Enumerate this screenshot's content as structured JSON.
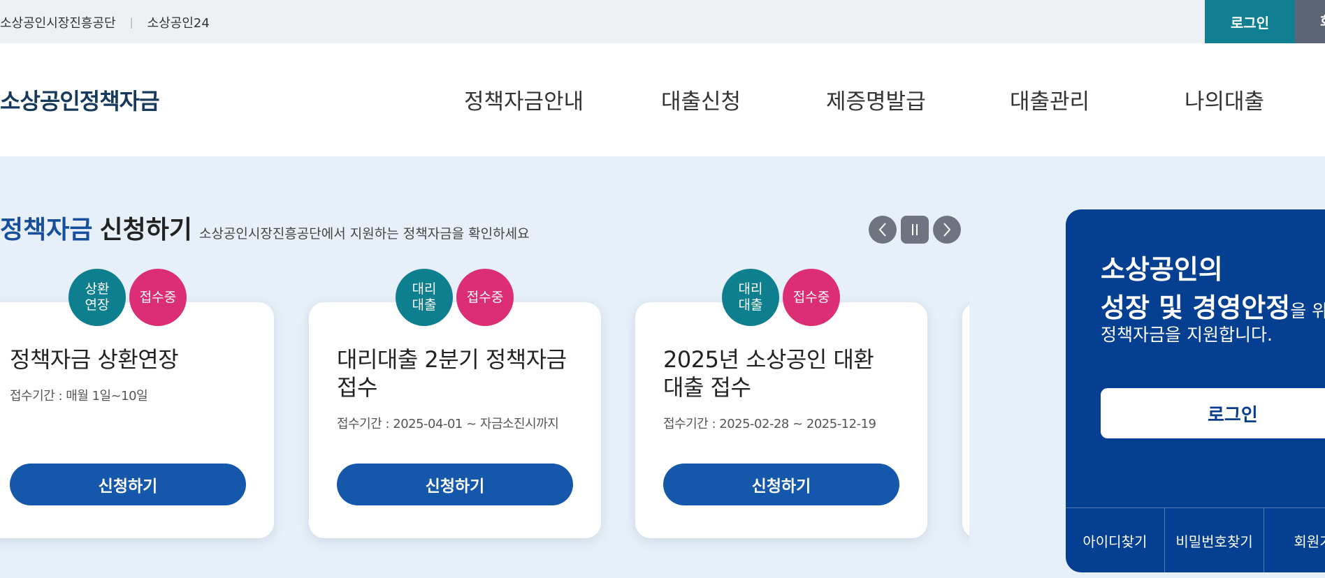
{
  "topbar": {
    "links": [
      "소상공인시장진흥공단",
      "소상공인24"
    ],
    "separator": "|",
    "login_label": "로그인",
    "join_label": "회원가입"
  },
  "header": {
    "logo": "소상공인정책자금",
    "menu": [
      "정책자금안내",
      "대출신청",
      "제증명발급",
      "대출관리",
      "나의대출"
    ]
  },
  "section": {
    "title_highlight": "정책자금",
    "title_rest": "신청하기",
    "description": "소상공인시장진흥공단에서 지원하는 정책자금을 확인하세요",
    "prev_icon": "chevron-left-icon",
    "pause_icon": "pause-icon",
    "next_icon": "chevron-right-icon"
  },
  "cards": [
    {
      "badge_type": "상환\n연장",
      "badge_status": "접수중",
      "title": "정책자금 상환연장",
      "period": "접수기간 : 매월 1일~10일",
      "button": "신청하기"
    },
    {
      "badge_type": "대리\n대출",
      "badge_status": "접수중",
      "title": "대리대출 2분기 정책자금 접수",
      "period": "접수기간 : 2025-04-01 ~ 자금소진시까지",
      "button": "신청하기"
    },
    {
      "badge_type": "대리\n대출",
      "badge_status": "접수중",
      "title": "2025년 소상공인 대환대출 접수",
      "period": "접수기간 : 2025-02-28 ~ 2025-12-19",
      "button": "신청하기"
    }
  ],
  "panel": {
    "line1": "소상공인의",
    "line2_bold": "성장 및 경영안정",
    "line2_rest": "을 위해",
    "line3": "정책자금을 지원합니다.",
    "login_label": "로그인",
    "links": [
      "아이디찾기",
      "비밀번호찾기",
      "회원가입"
    ]
  },
  "colors": {
    "accent_teal": "#0f7f91",
    "brand_blue": "#1557aa",
    "panel_blue": "#053f91",
    "badge_pink": "#dc2e74"
  }
}
